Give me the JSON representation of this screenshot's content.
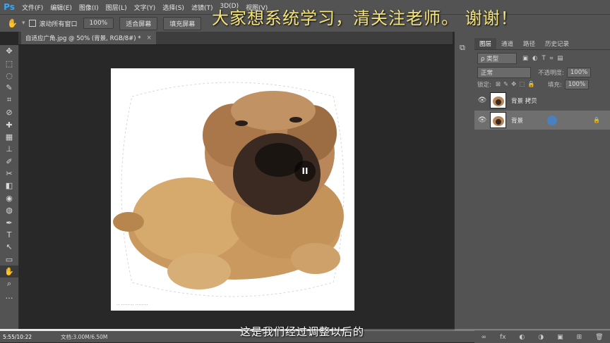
{
  "app": {
    "logo": "Ps"
  },
  "menu": [
    "文件(F)",
    "编辑(E)",
    "图像(I)",
    "图层(L)",
    "文字(Y)",
    "选择(S)",
    "滤镜(T)",
    "3D(D)",
    "视图(V)"
  ],
  "options": {
    "hand_icon": "hand-icon",
    "scroll_all_label": "滚动所有窗口",
    "zoom_label": "100%",
    "fit_screen_label": "适合屏幕",
    "fill_screen_label": "填充屏幕"
  },
  "document": {
    "tab_title": "自适应广角.jpg @ 50% (背景, RGB/8#) *",
    "close": "×"
  },
  "toolbar": {
    "tools": [
      "✥",
      "⬚",
      "◌",
      "✎",
      "⌗",
      "⊘",
      "✚",
      "▦",
      "⊥",
      "✐",
      "✂",
      "◧",
      "◉",
      "◍",
      "✒",
      "T",
      "↖",
      "▭",
      "✋",
      "⌕",
      "…"
    ]
  },
  "layers_panel": {
    "tabs": [
      "图层",
      "通道",
      "路径",
      "历史记录"
    ],
    "filter_label": "ρ 类型",
    "blend_mode": "正常",
    "opacity_label": "不透明度:",
    "opacity_value": "100%",
    "lock_label": "锁定:",
    "fill_label": "填充:",
    "fill_value": "100%",
    "layers": [
      {
        "name": "背景 拷贝",
        "selected": false
      },
      {
        "name": "背景",
        "selected": true,
        "lock": "🔒"
      }
    ],
    "footer_icons": [
      "∞",
      "fx",
      "◐",
      "◑",
      "▣",
      "⊞",
      "🗑"
    ]
  },
  "status": {
    "doc_size": "文档:3.00M/6.50M",
    "time": "5:55/10:22"
  },
  "overlay": {
    "banner": "大家想系统学习，清关注老师。 谢谢！",
    "subtitle": "这是我们经过调整以后的",
    "pause": "II",
    "progress": 0.57
  }
}
